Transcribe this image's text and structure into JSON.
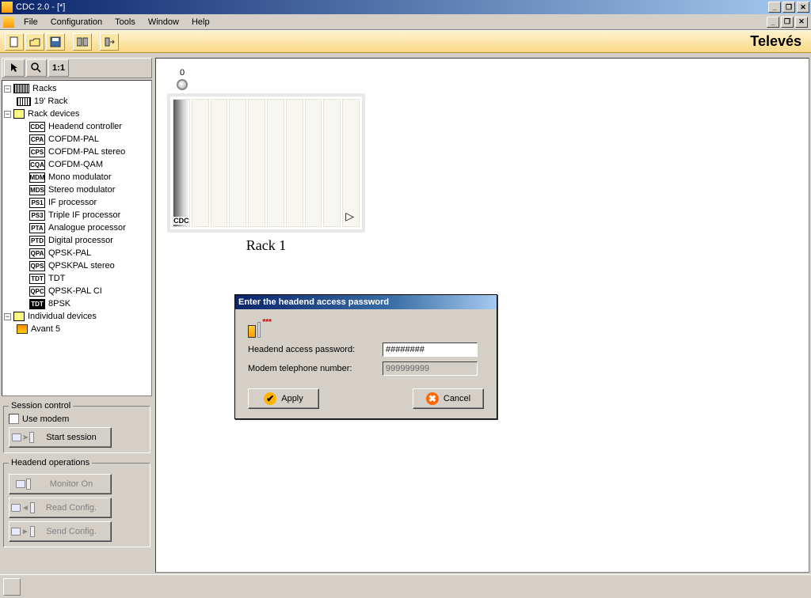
{
  "title": "CDC 2.0 - [*]",
  "menu": {
    "file": "File",
    "configuration": "Configuration",
    "tools": "Tools",
    "window": "Window",
    "help": "Help"
  },
  "brand": "Televés",
  "tree": {
    "racks": "Racks",
    "rack19": "19' Rack",
    "rackDevices": "Rack devices",
    "devices": [
      {
        "abbr": "CDC",
        "label": "Headend controller"
      },
      {
        "abbr": "CPA",
        "label": "COFDM-PAL"
      },
      {
        "abbr": "CPS",
        "label": "COFDM-PAL stereo"
      },
      {
        "abbr": "CQA",
        "label": "COFDM-QAM"
      },
      {
        "abbr": "MDM",
        "label": "Mono modulator"
      },
      {
        "abbr": "MDS",
        "label": "Stereo modulator"
      },
      {
        "abbr": "PS1",
        "label": "IF processor"
      },
      {
        "abbr": "PS3",
        "label": "Triple IF processor"
      },
      {
        "abbr": "PTA",
        "label": "Analogue processor"
      },
      {
        "abbr": "PTD",
        "label": "Digital processor"
      },
      {
        "abbr": "QPA",
        "label": "QPSK-PAL"
      },
      {
        "abbr": "QPS",
        "label": "QPSKPAL stereo"
      },
      {
        "abbr": "TDT",
        "label": "TDT"
      },
      {
        "abbr": "QPC",
        "label": "QPSK-PAL CI"
      },
      {
        "abbr": "TDT",
        "label": "8PSK",
        "inv": true
      }
    ],
    "individual": "Individual devices",
    "avant": "Avant 5"
  },
  "session": {
    "legend": "Session control",
    "use_modem": "Use modem",
    "start": "Start session"
  },
  "headend": {
    "legend": "Headend operations",
    "monitor": "Monitor On",
    "read": "Read Config.",
    "send": "Send Config."
  },
  "rack": {
    "top_index": "0",
    "slot0": "CDC",
    "title": "Rack 1"
  },
  "dialog": {
    "title": "Enter the headend access password",
    "label_password": "Headend access password:",
    "label_modem": "Modem telephone number:",
    "password_value": "########",
    "modem_value": "999999999",
    "apply": "Apply",
    "cancel": "Cancel"
  },
  "zoom_11": "1:1"
}
